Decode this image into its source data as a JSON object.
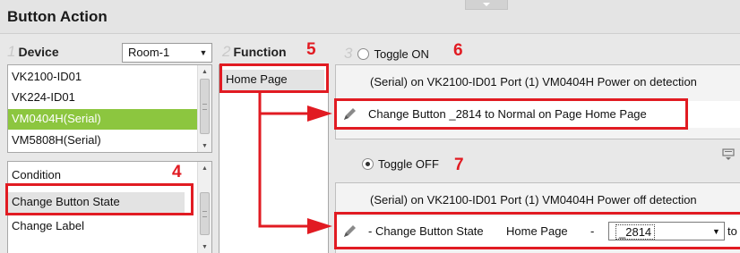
{
  "header": {
    "title": "Button Action"
  },
  "device_column": {
    "step": "1",
    "label": "Device",
    "room_select": "Room-1",
    "devices": [
      "VK2100-ID01",
      "VK224-ID01",
      "VM0404H(Serial)",
      "VM5808H(Serial)"
    ],
    "selected_device_index": 2,
    "actions": [
      "Condition",
      "Change Button State",
      "Change Label"
    ],
    "selected_action_index": 1
  },
  "function_column": {
    "step": "2",
    "label": "Function",
    "items": [
      "Home Page"
    ]
  },
  "toggle_column": {
    "step": "3",
    "toggle_on": {
      "label": "Toggle ON",
      "selected": false,
      "trigger_text": "(Serial) on VK2100-ID01 Port (1) VM0404H Power on detection",
      "action_text": "Change Button _2814 to Normal on Page Home Page"
    },
    "toggle_off": {
      "label": "Toggle OFF",
      "selected": true,
      "trigger_text": "(Serial) on VK2100-ID01 Port (1) VM0404H Power off detection",
      "action_prefix": "- Change Button State",
      "page_label": "Home Page",
      "dash": "-",
      "button_value": "_2814",
      "suffix": "to"
    }
  },
  "callouts": [
    "4",
    "5",
    "6",
    "7"
  ],
  "colors": {
    "accent_red": "#e11b22",
    "selected_green": "#8cc63f"
  },
  "icons": [
    "pencil-icon",
    "pencil-icon",
    "panel-toggle-icon",
    "chevron-down-icon"
  ]
}
